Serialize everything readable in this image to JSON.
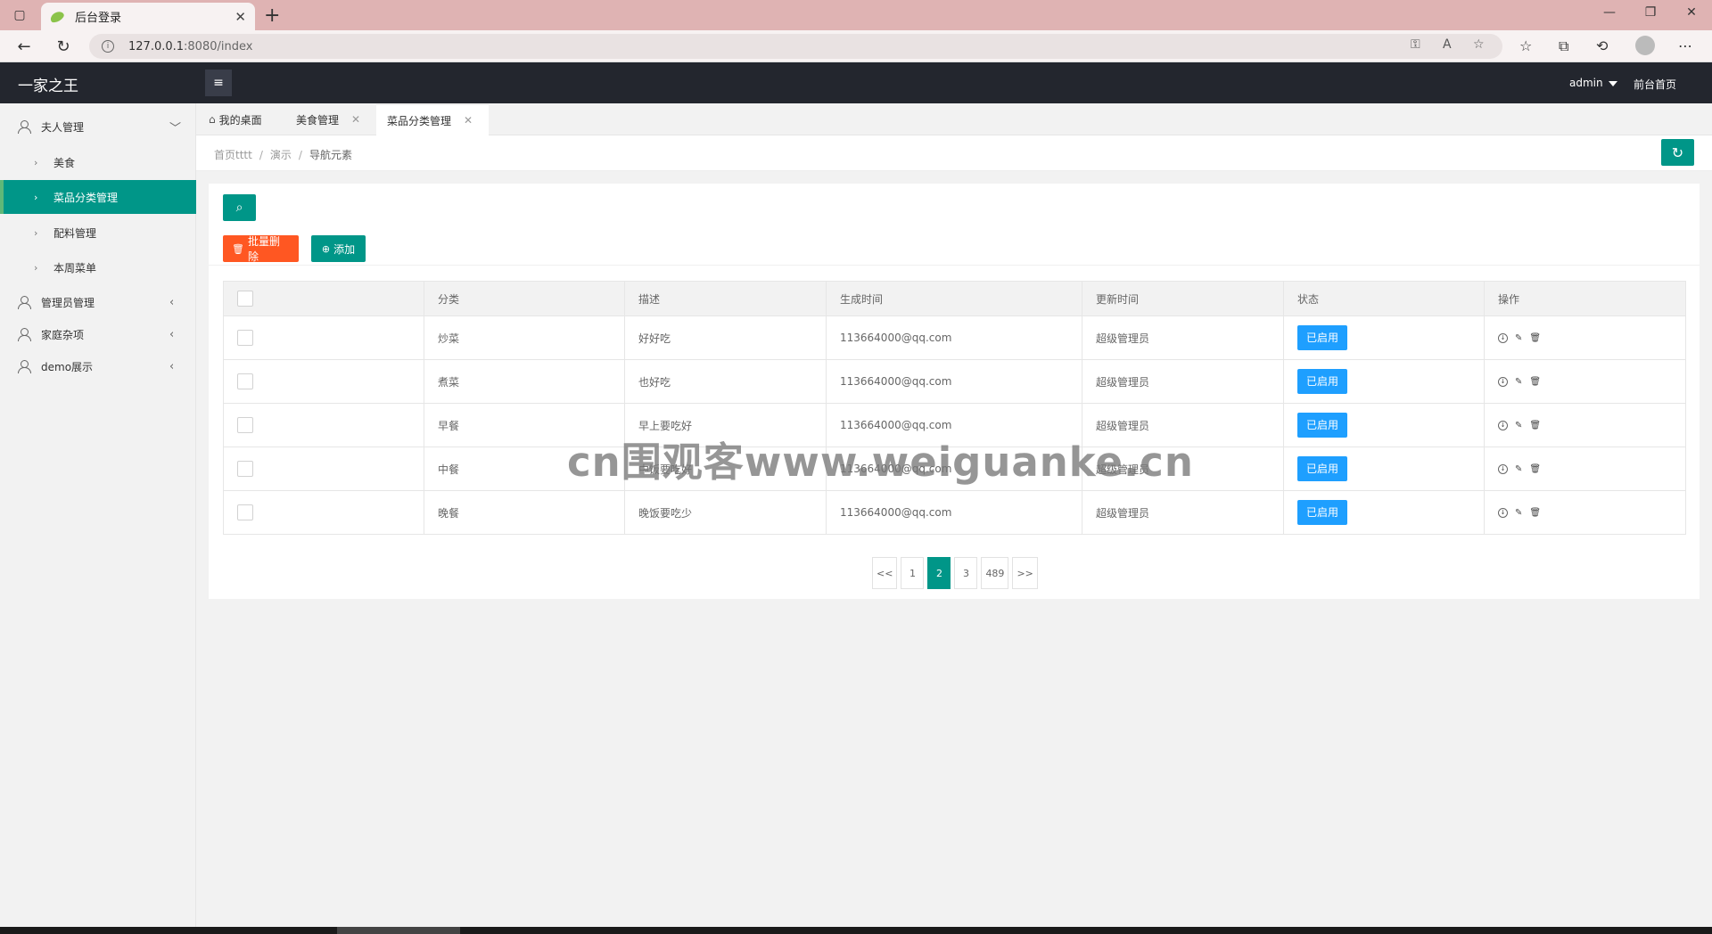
{
  "browser": {
    "tab_title": "后台登录",
    "url_host": "127.0.0.1",
    "url_rest": ":8080/index"
  },
  "header": {
    "logo": "一家之王",
    "user": "admin",
    "front_link": "前台首页"
  },
  "sidebar": {
    "groups": [
      {
        "label": "夫人管理"
      },
      {
        "label": "管理员管理"
      },
      {
        "label": "家庭杂项"
      },
      {
        "label": "demo展示"
      }
    ],
    "subitems": [
      {
        "label": "美食"
      },
      {
        "label": "菜品分类管理"
      },
      {
        "label": "配料管理"
      },
      {
        "label": "本周菜单"
      }
    ]
  },
  "page_tabs": [
    {
      "label": "我的桌面"
    },
    {
      "label": "美食管理"
    },
    {
      "label": "菜品分类管理"
    }
  ],
  "breadcrumb": [
    "首页tttt",
    "演示",
    "导航元素"
  ],
  "toolbar": {
    "batch_delete": "批量删除",
    "add": "添加"
  },
  "table": {
    "columns": [
      "分类",
      "描述",
      "生成时间",
      "更新时间",
      "状态",
      "操作"
    ],
    "rows": [
      {
        "category": "炒菜",
        "desc": "好好吃",
        "created": "113664000@qq.com",
        "updated": "超级管理员",
        "status": "已启用"
      },
      {
        "category": "煮菜",
        "desc": "也好吃",
        "created": "113664000@qq.com",
        "updated": "超级管理员",
        "status": "已启用"
      },
      {
        "category": "早餐",
        "desc": "早上要吃好",
        "created": "113664000@qq.com",
        "updated": "超级管理员",
        "status": "已启用"
      },
      {
        "category": "中餐",
        "desc": "中饭要吃好",
        "created": "113664000@qq.com",
        "updated": "超级管理员",
        "status": "已启用"
      },
      {
        "category": "晚餐",
        "desc": "晚饭要吃少",
        "created": "113664000@qq.com",
        "updated": "超级管理员",
        "status": "已启用"
      }
    ]
  },
  "pagination": {
    "prev": "<<",
    "pages": [
      "1",
      "2",
      "3",
      "489"
    ],
    "current": "2",
    "next": ">>"
  },
  "watermark": "cn围观客www.weiguanke.cn",
  "colors": {
    "primary": "#009688",
    "danger": "#ff5722",
    "status": "#1e9fff",
    "header_bg": "#23262e"
  }
}
